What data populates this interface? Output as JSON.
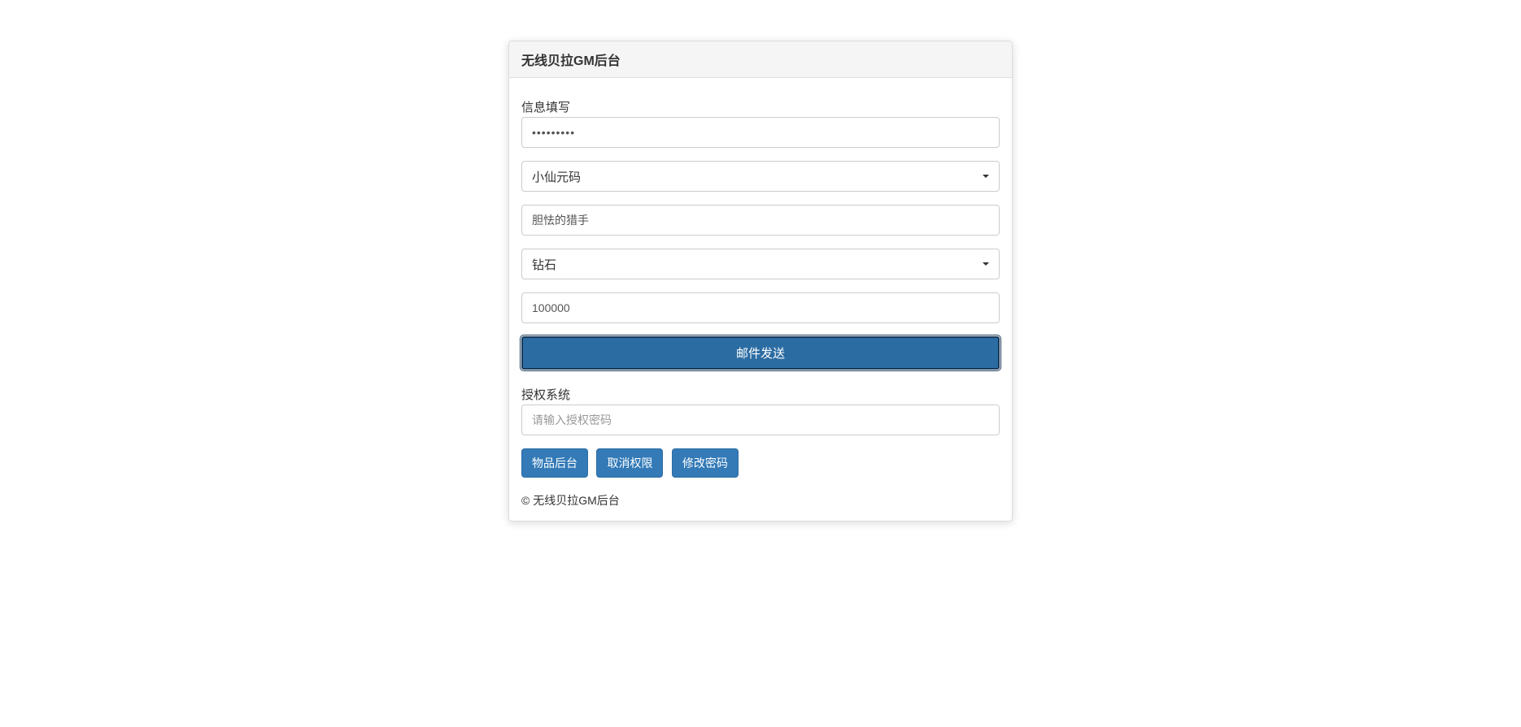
{
  "panel": {
    "title": "无线贝拉GM后台"
  },
  "form": {
    "section_label": "信息填写",
    "password_value": "•••••••••",
    "server_select": "小仙元码",
    "character_value": "胆怯的猎手",
    "item_select": "钻石",
    "amount_value": "100000",
    "send_button": "邮件发送"
  },
  "auth": {
    "section_label": "授权系统",
    "password_placeholder": "请输入授权密码"
  },
  "buttons": {
    "item_admin": "物品后台",
    "cancel_auth": "取消权限",
    "change_password": "修改密码"
  },
  "footer": "© 无线贝拉GM后台"
}
